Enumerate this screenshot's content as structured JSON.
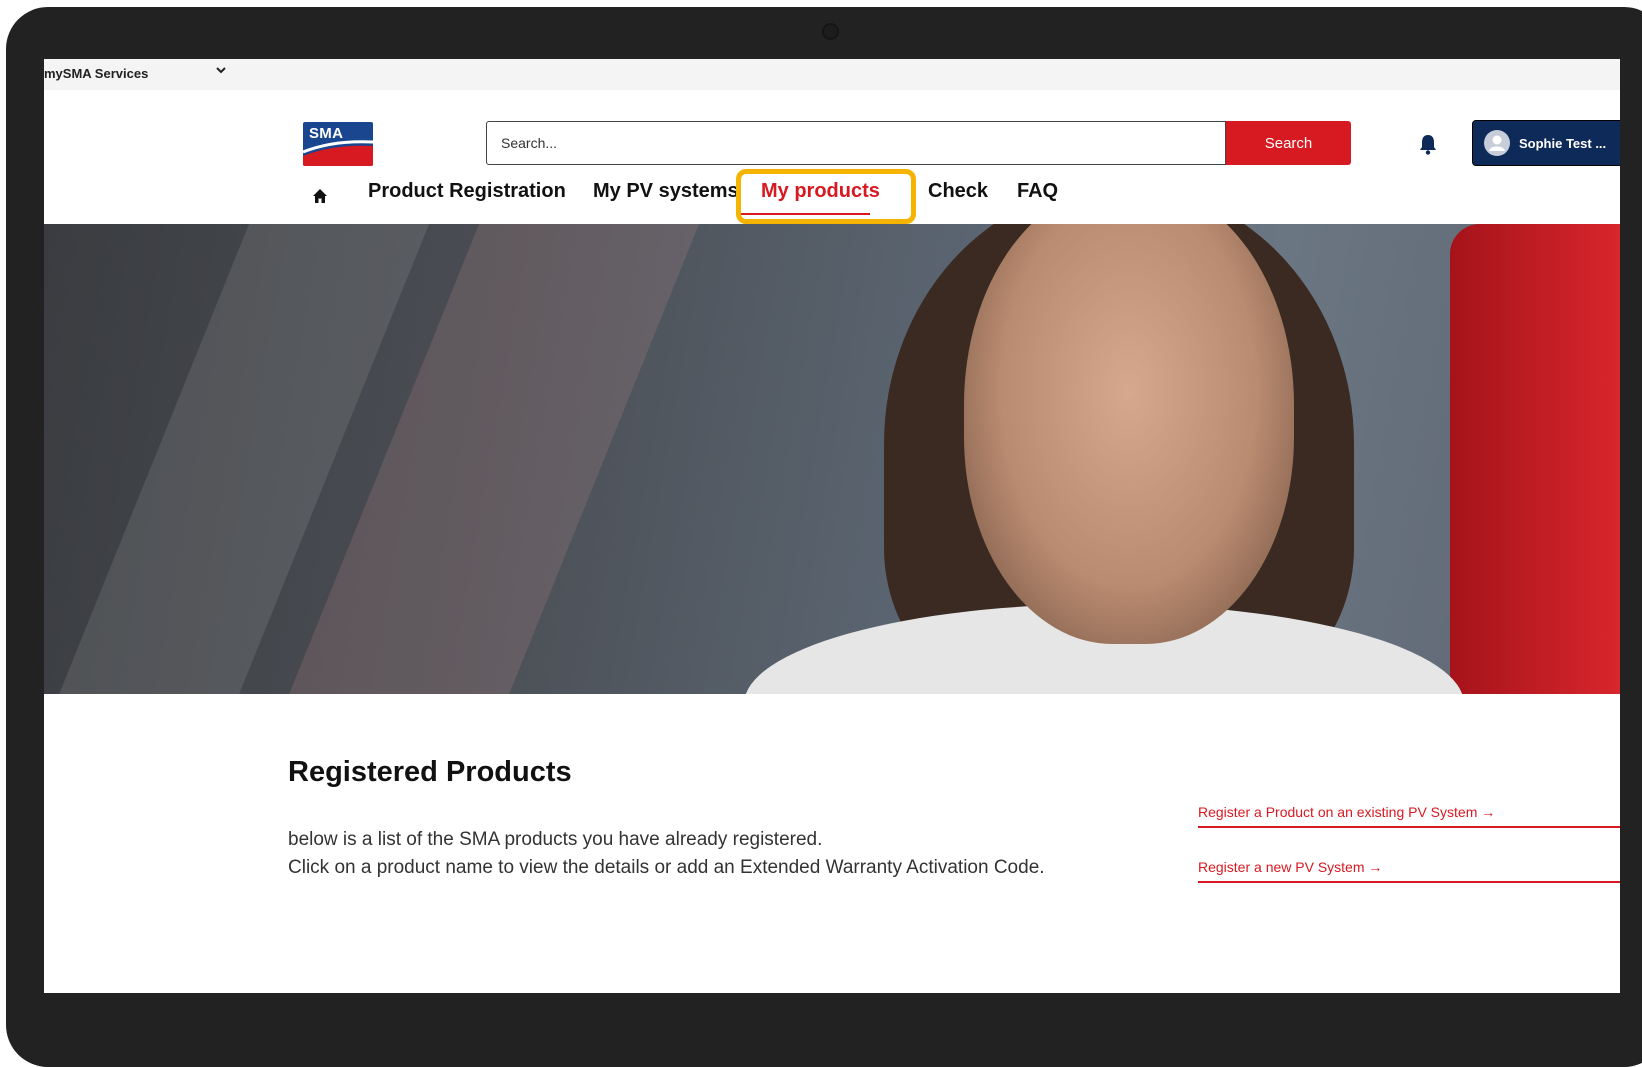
{
  "utility_bar": {
    "services_label": "mySMA Services"
  },
  "header": {
    "logo_text": "SMA",
    "search": {
      "placeholder": "Search...",
      "button_label": "Search"
    },
    "user": {
      "name": "Sophie Test ..."
    }
  },
  "nav": {
    "items": [
      {
        "label": "Product Registration"
      },
      {
        "label": "My PV systems"
      },
      {
        "label": "My products",
        "active": true
      },
      {
        "label": "Check"
      },
      {
        "label": "FAQ"
      }
    ]
  },
  "content": {
    "title": "Registered Products",
    "description_line1": "below is a list of the SMA products you have already registered.",
    "description_line2": "Click on a product name to view the details or add an Extended Warranty Activation Code.",
    "links": [
      {
        "label": "Register a Product on an existing PV System →"
      },
      {
        "label": "Register a new PV System →"
      }
    ]
  },
  "colors": {
    "accent": "#d71921",
    "brand_blue": "#1a4690",
    "highlight": "#f5b400",
    "user_button": "#0e2a59"
  },
  "icons": [
    "chevron-down-icon",
    "home-icon",
    "bell-icon",
    "user-avatar-icon",
    "caret-down-icon"
  ]
}
